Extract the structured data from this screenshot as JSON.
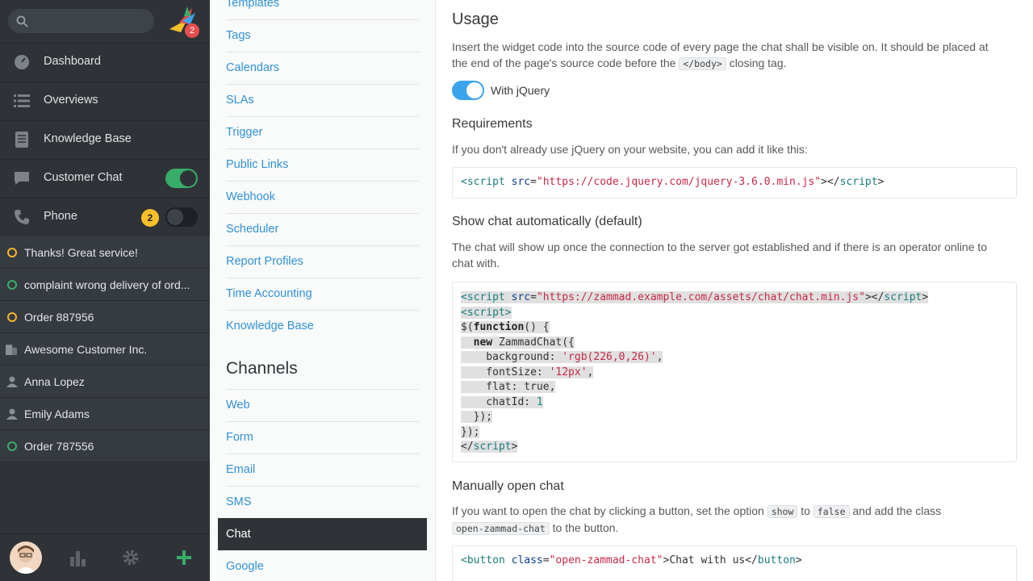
{
  "nav": {
    "logo_badge": "2",
    "items": [
      {
        "label": "Dashboard"
      },
      {
        "label": "Overviews"
      },
      {
        "label": "Knowledge Base"
      },
      {
        "label": "Customer Chat"
      },
      {
        "label": "Phone",
        "badge": "2"
      }
    ],
    "tasks": [
      {
        "label": "Thanks! Great service!",
        "kind": "ticket",
        "color": "#f5b62b"
      },
      {
        "label": "complaint wrong delivery of ord...",
        "kind": "ticket",
        "color": "#38ad69"
      },
      {
        "label": "Order 887956",
        "kind": "ticket",
        "color": "#f5b62b"
      },
      {
        "label": "Awesome Customer Inc.",
        "kind": "organization"
      },
      {
        "label": "Anna Lopez",
        "kind": "user"
      },
      {
        "label": "Emily Adams",
        "kind": "user"
      },
      {
        "label": "Order 787556",
        "kind": "ticket",
        "color": "#38ad69"
      }
    ],
    "toggle_on_color": "#38ad69"
  },
  "settings": {
    "links_top": [
      "Templates",
      "Tags",
      "Calendars",
      "SLAs",
      "Trigger",
      "Public Links",
      "Webhook",
      "Scheduler",
      "Report Profiles",
      "Time Accounting",
      "Knowledge Base"
    ],
    "channels_heading": "Channels",
    "channel_links": [
      "Web",
      "Form",
      "Email",
      "SMS",
      "Chat",
      "Google"
    ],
    "active": "Chat"
  },
  "main": {
    "usage_title": "Usage",
    "usage_text_1": "Insert the widget code into the source code of every page the chat shall be visible on. It should be placed at",
    "usage_text_2a": "the end of the page's source code before the",
    "usage_code": "</body>",
    "usage_text_2b": "closing tag.",
    "jquery_label": "With jQuery",
    "req_title": "Requirements",
    "req_text": "If you don't already use jQuery on your website, you can add it like this:",
    "req_code": {
      "src_val": "\"https://code.jquery.com/jquery-3.6.0.min.js\""
    },
    "auto_title": "Show chat automatically (default)",
    "auto_text_1": "The chat will show up once the connection to the server got established and if there is an operator online to",
    "auto_text_2": "chat with.",
    "auto_code": {
      "src_val": "\"https://zammad.example.com/assets/chat/chat.min.js\"",
      "background": "'rgb(226,0,26)'",
      "fontsize": "'12px'",
      "flat": "true",
      "chatid": "1"
    },
    "manual_title": "Manually open chat",
    "manual_text_a": "If you want to open the chat by clicking a button, set the option",
    "manual_code_show": "show",
    "manual_text_b": "to",
    "manual_code_false": "false",
    "manual_text_c": "and add the class",
    "manual_code_class": "open-zammad-chat",
    "manual_text_d": "to the button.",
    "manual_code": {
      "class_val": "\"open-zammad-chat\"",
      "inner": "Chat with us"
    }
  }
}
